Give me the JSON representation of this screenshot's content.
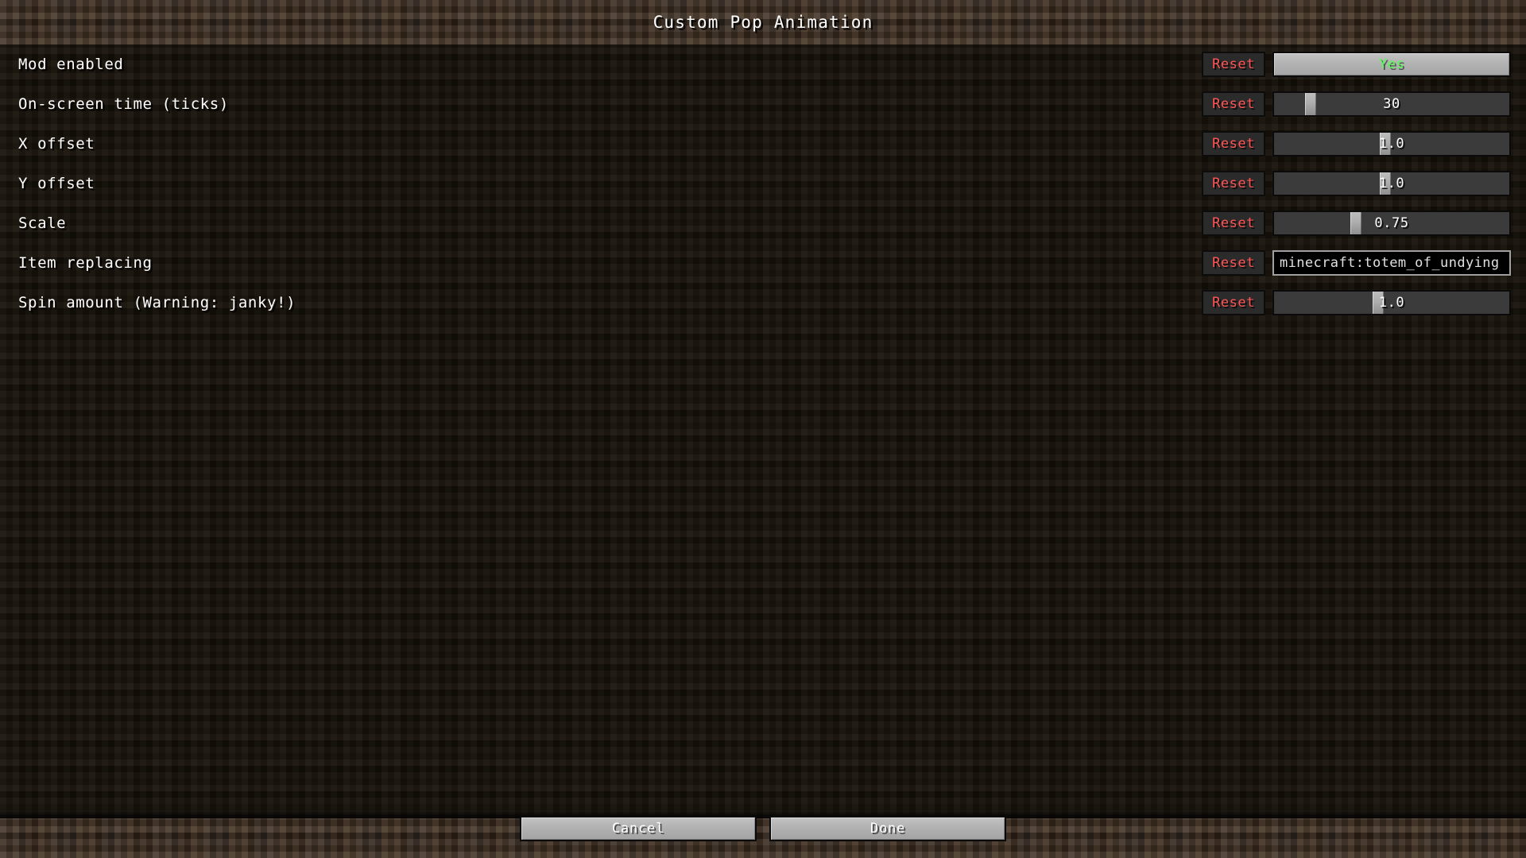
{
  "header": {
    "title": "Custom Pop Animation"
  },
  "options": [
    {
      "label": "Mod enabled",
      "reset_label": "Reset",
      "control": "toggle",
      "value": "Yes",
      "value_color": "#55ff55"
    },
    {
      "label": "On-screen time (ticks)",
      "reset_label": "Reset",
      "control": "slider",
      "value": "30",
      "handle_percent": 14
    },
    {
      "label": "X offset",
      "reset_label": "Reset",
      "control": "slider",
      "value": "1.0",
      "handle_percent": 47
    },
    {
      "label": "Y offset",
      "reset_label": "Reset",
      "control": "slider",
      "value": "1.0",
      "handle_percent": 47
    },
    {
      "label": "Scale",
      "reset_label": "Reset",
      "control": "slider",
      "value": "0.75",
      "handle_percent": 34
    },
    {
      "label": "Item replacing",
      "reset_label": "Reset",
      "control": "text",
      "value": "minecraft:totem_of_undying"
    },
    {
      "label": "Spin amount (Warning: janky!)",
      "reset_label": "Reset",
      "control": "slider",
      "value": "1.0",
      "handle_percent": 44
    }
  ],
  "footer": {
    "cancel_label": "Cancel",
    "done_label": "Done"
  },
  "colors": {
    "reset_text": "#ff5555",
    "toggle_yes": "#55ff55",
    "dirt_header": "#342519",
    "body_background": "#140f08",
    "button_face": "#b4b4b4"
  }
}
